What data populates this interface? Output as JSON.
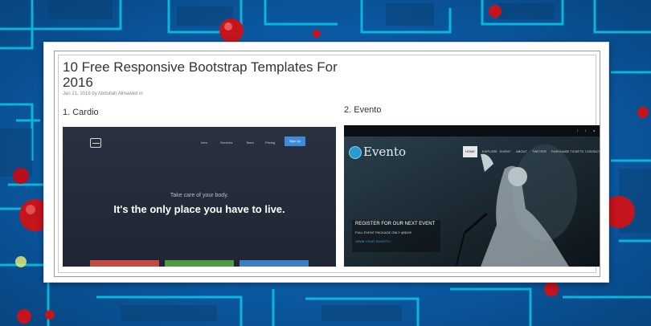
{
  "article": {
    "title": "10 Free Responsive Bootstrap Templates For 2016",
    "meta": "Jan 21, 2016 by Abdullah Almawed in"
  },
  "items": [
    {
      "heading": "1. Cardio",
      "nav": [
        "Intro",
        "Services",
        "Team",
        "Pricing"
      ],
      "signup": "Sign Up",
      "tagline": "Take care of your body.",
      "headline": "It's the only place you have to live."
    },
    {
      "heading": "2. Evento",
      "logo": "Evento",
      "nav": [
        "HOME",
        "EXPLORE",
        "EVENT",
        "ABOUT",
        "TWITTER",
        "PURCHASE TICKETS",
        "CONTACT"
      ],
      "card_title": "REGISTER FOR OUR NEXT EVENT",
      "card_sub": "FULL EVENT PACKAGE ONLY @$199",
      "card_link": "GRAB YOUR TICKETS ›"
    }
  ],
  "colors": {
    "frame_orange": "#e88a2a",
    "frame_green": "#8a9a5b",
    "signup_blue": "#3d8bd9"
  }
}
